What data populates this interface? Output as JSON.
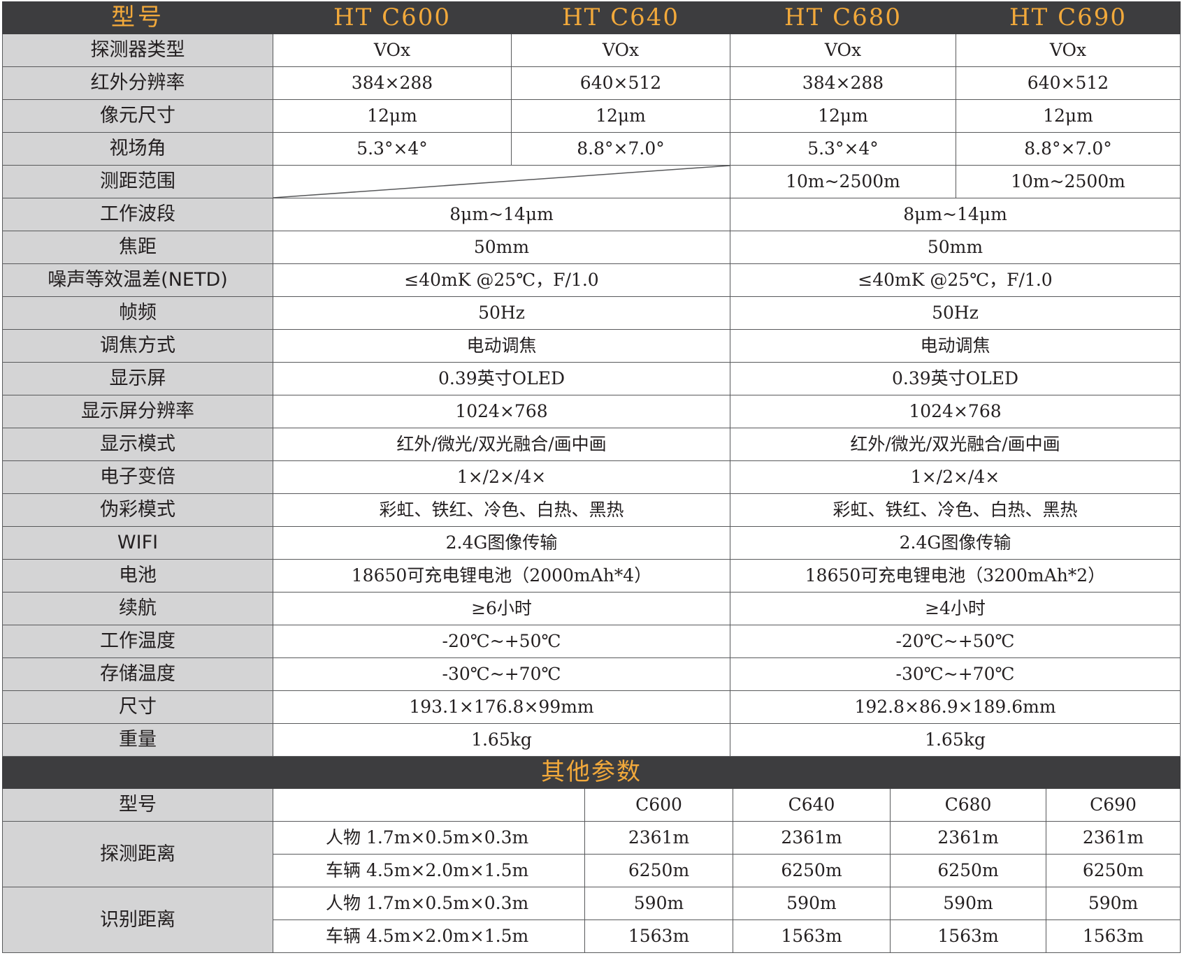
{
  "header": {
    "model_label": "型号",
    "models": [
      "HT C600",
      "HT C640",
      "HT C680",
      "HT C690"
    ]
  },
  "specs": {
    "detector_type": {
      "label": "探测器类型",
      "values": [
        "VOx",
        "VOx",
        "VOx",
        "VOx"
      ]
    },
    "ir_resolution": {
      "label": "红外分辨率",
      "values": [
        "384×288",
        "640×512",
        "384×288",
        "640×512"
      ]
    },
    "pixel_size": {
      "label": "像元尺寸",
      "values": [
        "12μm",
        "12μm",
        "12μm",
        "12μm"
      ]
    },
    "fov": {
      "label": "视场角",
      "values": [
        "5.3°×4°",
        "8.8°×7.0°",
        "5.3°×4°",
        "8.8°×7.0°"
      ]
    },
    "ranging": {
      "label": "测距范围",
      "values": [
        "10m~2500m",
        "10m~2500m"
      ]
    },
    "waveband": {
      "label": "工作波段",
      "values": [
        "8μm~14μm",
        "8μm~14μm"
      ]
    },
    "focal_length": {
      "label": "焦距",
      "values": [
        "50mm",
        "50mm"
      ]
    },
    "netd": {
      "label": "噪声等效温差(NETD)",
      "values": [
        "≤40mK @25℃，F/1.0",
        "≤40mK @25℃，F/1.0"
      ]
    },
    "frame_rate": {
      "label": "帧频",
      "values": [
        "50Hz",
        "50Hz"
      ]
    },
    "focus": {
      "label": "调焦方式",
      "values": [
        "电动调焦",
        "电动调焦"
      ]
    },
    "display": {
      "label": "显示屏",
      "values": [
        "0.39英寸OLED",
        "0.39英寸OLED"
      ]
    },
    "display_res": {
      "label": "显示屏分辨率",
      "values": [
        "1024×768",
        "1024×768"
      ]
    },
    "display_mode": {
      "label": "显示模式",
      "values": [
        "红外/微光/双光融合/画中画",
        "红外/微光/双光融合/画中画"
      ]
    },
    "zoom": {
      "label": "电子变倍",
      "values": [
        "1×/2×/4×",
        "1×/2×/4×"
      ]
    },
    "palette": {
      "label": "伪彩模式",
      "values": [
        "彩虹、铁红、冷色、白热、黑热",
        "彩虹、铁红、冷色、白热、黑热"
      ]
    },
    "wifi": {
      "label": "WIFI",
      "values": [
        "2.4G图像传输",
        "2.4G图像传输"
      ]
    },
    "battery": {
      "label": "电池",
      "values": [
        "18650可充电锂电池（2000mAh*4）",
        "18650可充电锂电池（3200mAh*2）"
      ]
    },
    "endurance": {
      "label": "续航",
      "values": [
        "≥6小时",
        "≥4小时"
      ]
    },
    "op_temp": {
      "label": "工作温度",
      "values": [
        "-20℃~+50℃",
        "-20℃~+50℃"
      ]
    },
    "storage_temp": {
      "label": "存储温度",
      "values": [
        "-30℃~+70℃",
        "-30℃~+70℃"
      ]
    },
    "size": {
      "label": "尺寸",
      "values": [
        "193.1×176.8×99mm",
        "192.8×86.9×189.6mm"
      ]
    },
    "weight": {
      "label": "重量",
      "values": [
        "1.65kg",
        "1.65kg"
      ]
    }
  },
  "other": {
    "title": "其他参数",
    "model_label": "型号",
    "models": [
      "C600",
      "C640",
      "C680",
      "C690"
    ],
    "detection": {
      "label": "探测距离",
      "rows": [
        {
          "target": "人物  1.7m×0.5m×0.3m",
          "values": [
            "2361m",
            "2361m",
            "2361m",
            "2361m"
          ]
        },
        {
          "target": "车辆  4.5m×2.0m×1.5m",
          "values": [
            "6250m",
            "6250m",
            "6250m",
            "6250m"
          ]
        }
      ]
    },
    "recognition": {
      "label": "识别距离",
      "rows": [
        {
          "target": "人物  1.7m×0.5m×0.3m",
          "values": [
            "590m",
            "590m",
            "590m",
            "590m"
          ]
        },
        {
          "target": "车辆  4.5m×2.0m×1.5m",
          "values": [
            "1563m",
            "1563m",
            "1563m",
            "1563m"
          ]
        }
      ]
    }
  },
  "colors": {
    "header_bg": "#3d3d3f",
    "header_text": "#f2a93b",
    "label_bg": "#d4d4d5"
  }
}
